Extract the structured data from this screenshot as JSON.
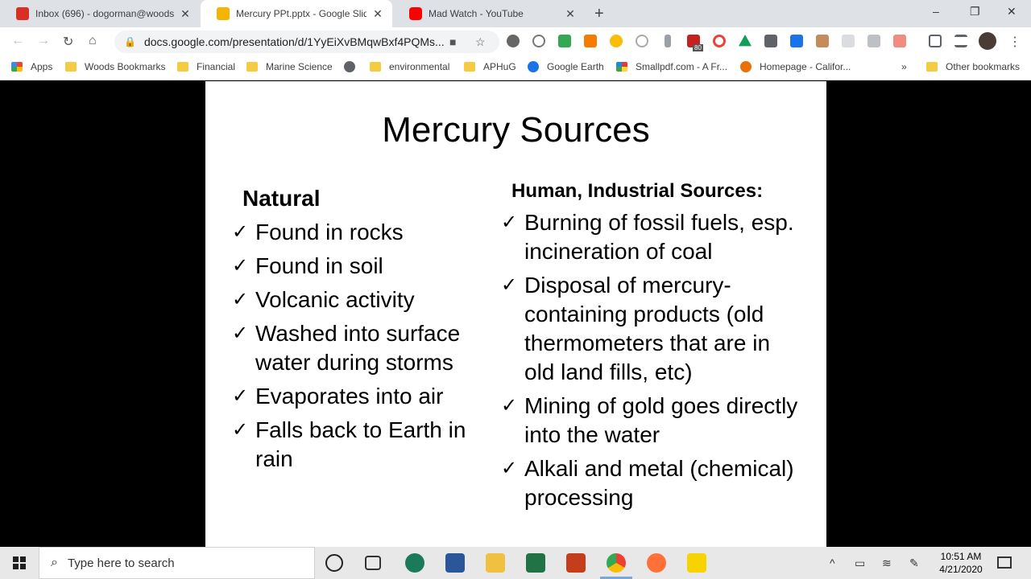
{
  "tabs": [
    {
      "title": "Inbox (696) - dogorman@woods",
      "favicon_color": "#d93025",
      "active": false
    },
    {
      "title": "Mercury PPt.pptx - Google Slides",
      "favicon_color": "#f4b400",
      "active": true
    },
    {
      "title": "Mad Watch - YouTube",
      "favicon_color": "#ff0000",
      "active": false
    }
  ],
  "new_tab": "+",
  "window_controls": {
    "minimize": "–",
    "restore": "❐",
    "close": "✕"
  },
  "address": {
    "url": "docs.google.com/presentation/d/1YyEiXvBMqwBxf4PQMs..."
  },
  "extension_badge": "80",
  "bookmarks": [
    {
      "label": "Apps",
      "icon": "apps-grid-icon"
    },
    {
      "label": "Woods Bookmarks",
      "icon": "folder-icon"
    },
    {
      "label": "Financial",
      "icon": "folder-icon"
    },
    {
      "label": "Marine Science",
      "icon": "folder-icon"
    },
    {
      "label": "",
      "icon": "globe-icon"
    },
    {
      "label": "environmental",
      "icon": "folder-icon"
    },
    {
      "label": "APHuG",
      "icon": "folder-icon"
    },
    {
      "label": "Google Earth",
      "icon": "earth-icon"
    },
    {
      "label": "Smallpdf.com - A Fr...",
      "icon": "smallpdf-icon"
    },
    {
      "label": "Homepage - Califor...",
      "icon": "homepage-icon"
    },
    {
      "label": "»",
      "icon": ""
    },
    {
      "label": "Other bookmarks",
      "icon": "folder-icon"
    }
  ],
  "slide": {
    "title": "Mercury Sources",
    "left": {
      "heading": "Natural",
      "items": [
        "Found in rocks",
        "Found in soil",
        "Volcanic activity",
        "Washed into surface water during storms",
        "Evaporates into air",
        "Falls back to Earth in rain"
      ]
    },
    "right": {
      "heading": "Human, Industrial Sources:",
      "items": [
        "Burning of fossil fuels, esp. incineration of coal",
        "Disposal of mercury-containing products (old thermometers that are in old land fills, etc)",
        "Mining of gold goes directly into the water",
        "Alkali and metal (chemical) processing"
      ]
    },
    "check": "✓"
  },
  "taskbar": {
    "search_placeholder": "Type here to search",
    "time": "10:51 AM",
    "date": "4/21/2020"
  }
}
